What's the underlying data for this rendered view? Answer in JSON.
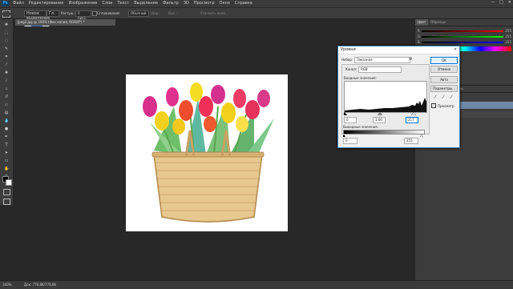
{
  "app": {
    "logo": "Ps"
  },
  "menu": {
    "items": [
      "Файл",
      "Редактирование",
      "Изображение",
      "Слои",
      "Текст",
      "Выделение",
      "Фильтр",
      "3D",
      "Просмотр",
      "Окно",
      "Справка"
    ]
  },
  "window_controls": {
    "minimize": "—",
    "maximize": "□",
    "close": "✕"
  },
  "options_bar": {
    "field1": "Новое выделение",
    "field2": "Гл.",
    "label3": "Растуш.:",
    "field3": "0 пикс.",
    "label4": "Сглаживание",
    "field5": "Обычный",
    "label6": "Шир.:",
    "label7": "Выс.:",
    "label8": "Уточнить край..."
  },
  "document": {
    "tab_title": "Jpeg2.jpg @ 100% (Фон копия, RGB/8*) *",
    "zoom": "100%",
    "doc_info": "Док: 776,8K/776,8K"
  },
  "right_panels": {
    "top_tabs": [
      "Цвет",
      "Образцы"
    ],
    "slider_labels": [
      "R",
      "G",
      "B"
    ],
    "slider_values": [
      "255",
      "255",
      "255"
    ],
    "mid_tabs": [
      "Слои",
      "Каналы",
      "Контуры"
    ],
    "layer_label": "Непрозрачность",
    "layer_rows": [
      "Фон копия",
      "Фон"
    ]
  },
  "levels_dialog": {
    "title": "Уровни",
    "preset_label": "Набор:",
    "preset_value": "Заказная",
    "channel_label": "Канал:",
    "channel_value": "RGB",
    "input_label": "Входные значения:",
    "input_black": "0",
    "input_mid": "1,00",
    "input_white": "217",
    "output_label": "Выходные значения:",
    "output_black": "0",
    "output_white": "255",
    "buttons": {
      "ok": "OK",
      "cancel": "Отмена",
      "auto": "Авто",
      "options": "Параметры..."
    },
    "preview_label": "Просмотр",
    "preview_checked": true
  },
  "colors": {
    "accent": "#31a8ff",
    "dialog_border": "#3c7fb1",
    "panel_bg": "#3c3c3c",
    "workspace_bg": "#282828"
  }
}
